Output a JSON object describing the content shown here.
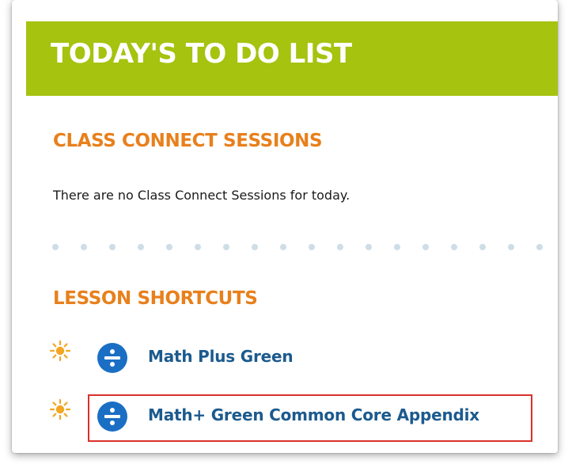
{
  "todo": {
    "title": "TODAY'S TO DO LIST"
  },
  "class_connect": {
    "title": "CLASS CONNECT SESSIONS",
    "message": "There are no Class Connect Sessions for today."
  },
  "lesson_shortcuts": {
    "title": "LESSON SHORTCUTS",
    "items": [
      {
        "label": "Math Plus Green",
        "icon": "divide-icon",
        "marker": "sun-icon"
      },
      {
        "label": "Math+ Green Common Core Appendix",
        "icon": "divide-icon",
        "marker": "sun-icon",
        "highlighted": true
      }
    ]
  },
  "colors": {
    "header_bg": "#a5c30f",
    "section_title": "#e8801c",
    "link": "#1c5a8e",
    "icon_blue": "#1a6fc4",
    "sun": "#f2a623",
    "dots": "#cfdde6",
    "highlight": "#d9312a"
  }
}
